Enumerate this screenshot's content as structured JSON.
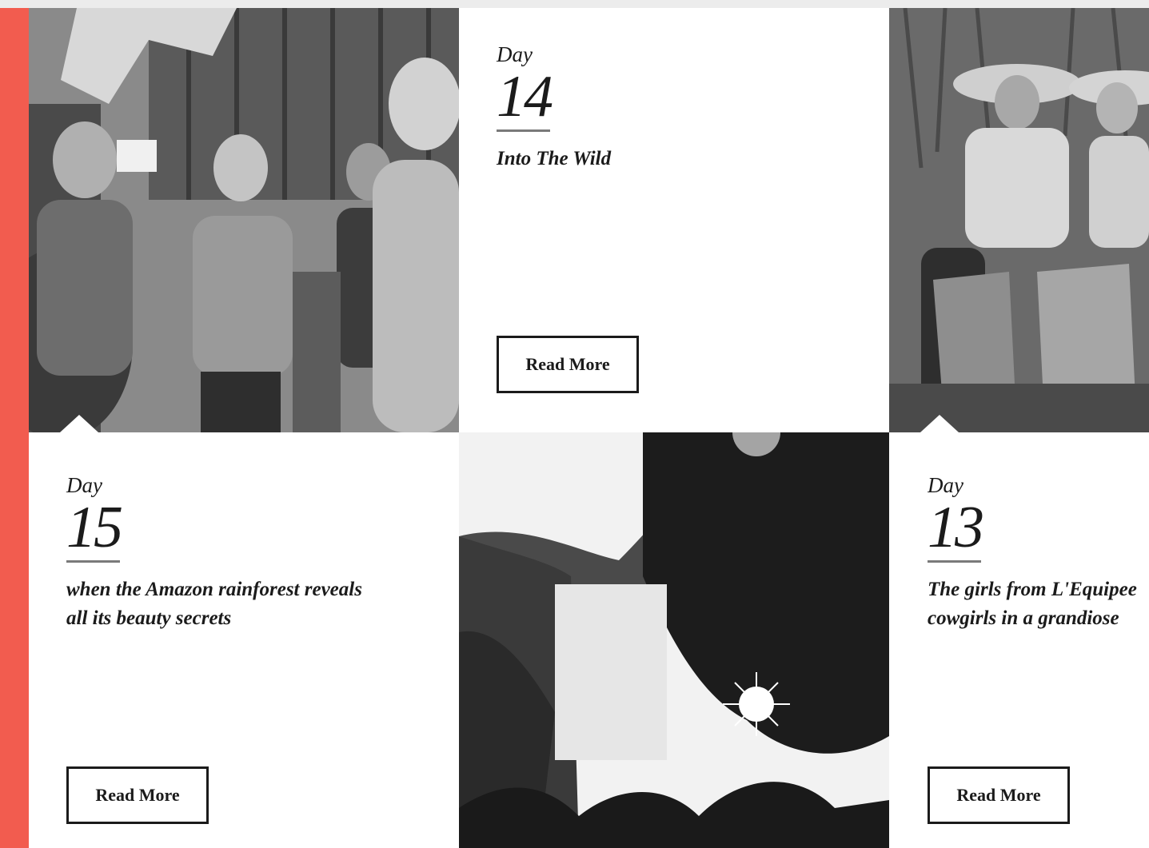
{
  "cards": [
    {
      "day_label": "Day",
      "day_number": "14",
      "subtitle_lines": [
        "Into The Wild"
      ],
      "button_label": "Read More"
    },
    {
      "day_label": "Day",
      "day_number": "15",
      "subtitle_lines": [
        "when the Amazon rainforest reveals",
        "all its beauty secrets"
      ],
      "button_label": "Read More"
    },
    {
      "day_label": "Day",
      "day_number": "13",
      "subtitle_lines": [
        "The girls from L'Equipee",
        "cowgirls in a grandiose"
      ],
      "button_label": "Read More"
    }
  ],
  "colors": {
    "accent": "#f25c4f",
    "text": "#1b1b1b",
    "rule": "#7a7a7a",
    "topbar": "#ececec"
  }
}
